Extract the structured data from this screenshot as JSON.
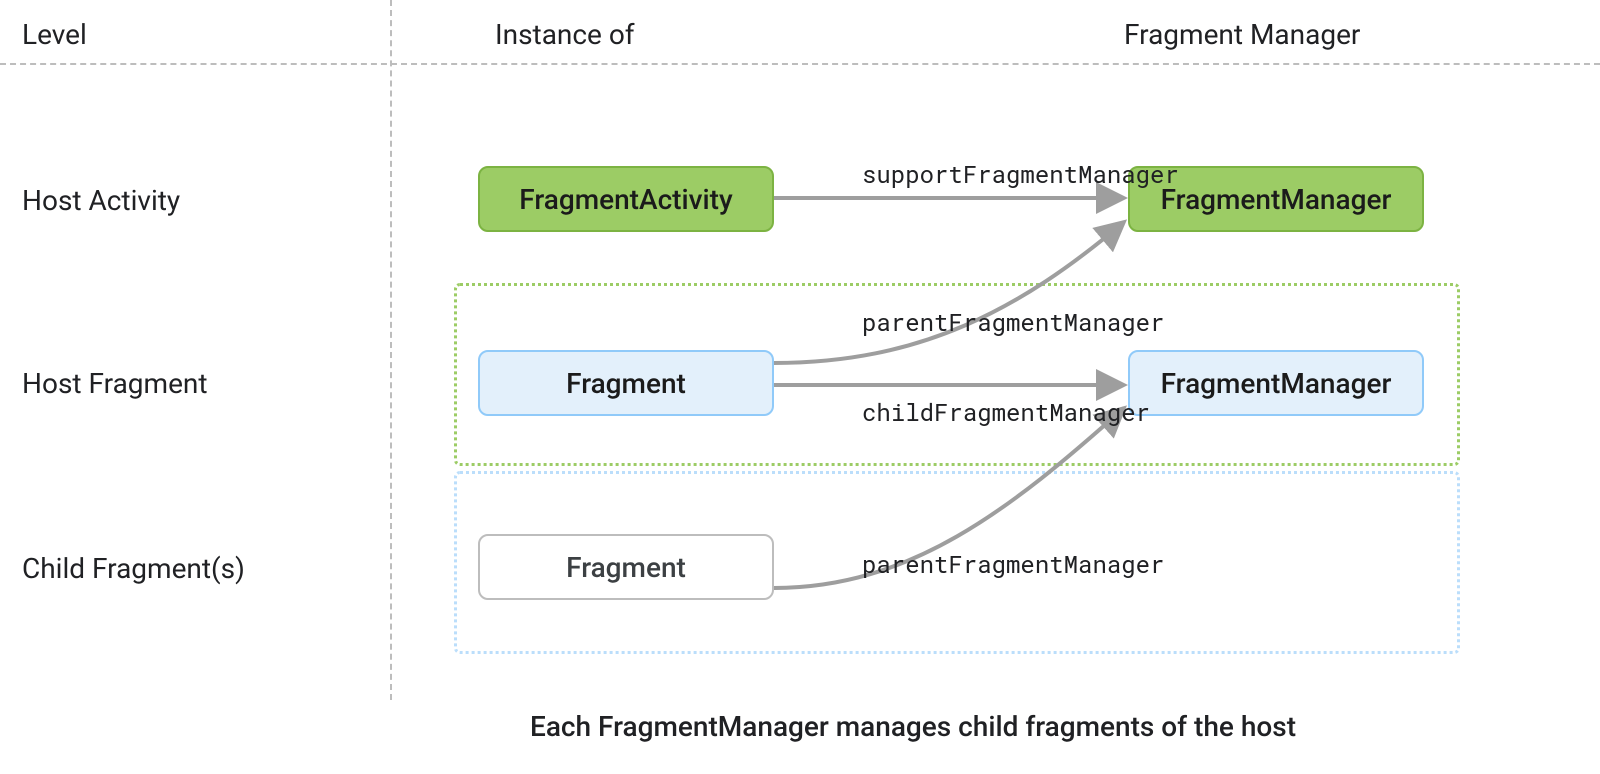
{
  "headers": {
    "level": "Level",
    "instance_of": "Instance of",
    "fragment_manager": "Fragment Manager"
  },
  "levels": {
    "host_activity": "Host Activity",
    "host_fragment": "Host Fragment",
    "child_fragments": "Child Fragment(s)"
  },
  "nodes": {
    "fragment_activity": "FragmentActivity",
    "activity_fm": "FragmentManager",
    "host_fragment": "Fragment",
    "host_fragment_fm": "FragmentManager",
    "child_fragment": "Fragment"
  },
  "edges": {
    "support_fm": "supportFragmentManager",
    "host_parent_fm": "parentFragmentManager",
    "host_child_fm": "childFragmentManager",
    "child_parent_fm": "parentFragmentManager"
  },
  "caption": "Each FragmentManager manages child fragments of the host",
  "colors": {
    "green_fill": "#9ccc65",
    "green_border": "#7cb342",
    "blue_fill": "#e3f0fb",
    "blue_border": "#90caf9",
    "arrow": "#9e9e9e",
    "dash": "#bdbdbd"
  }
}
